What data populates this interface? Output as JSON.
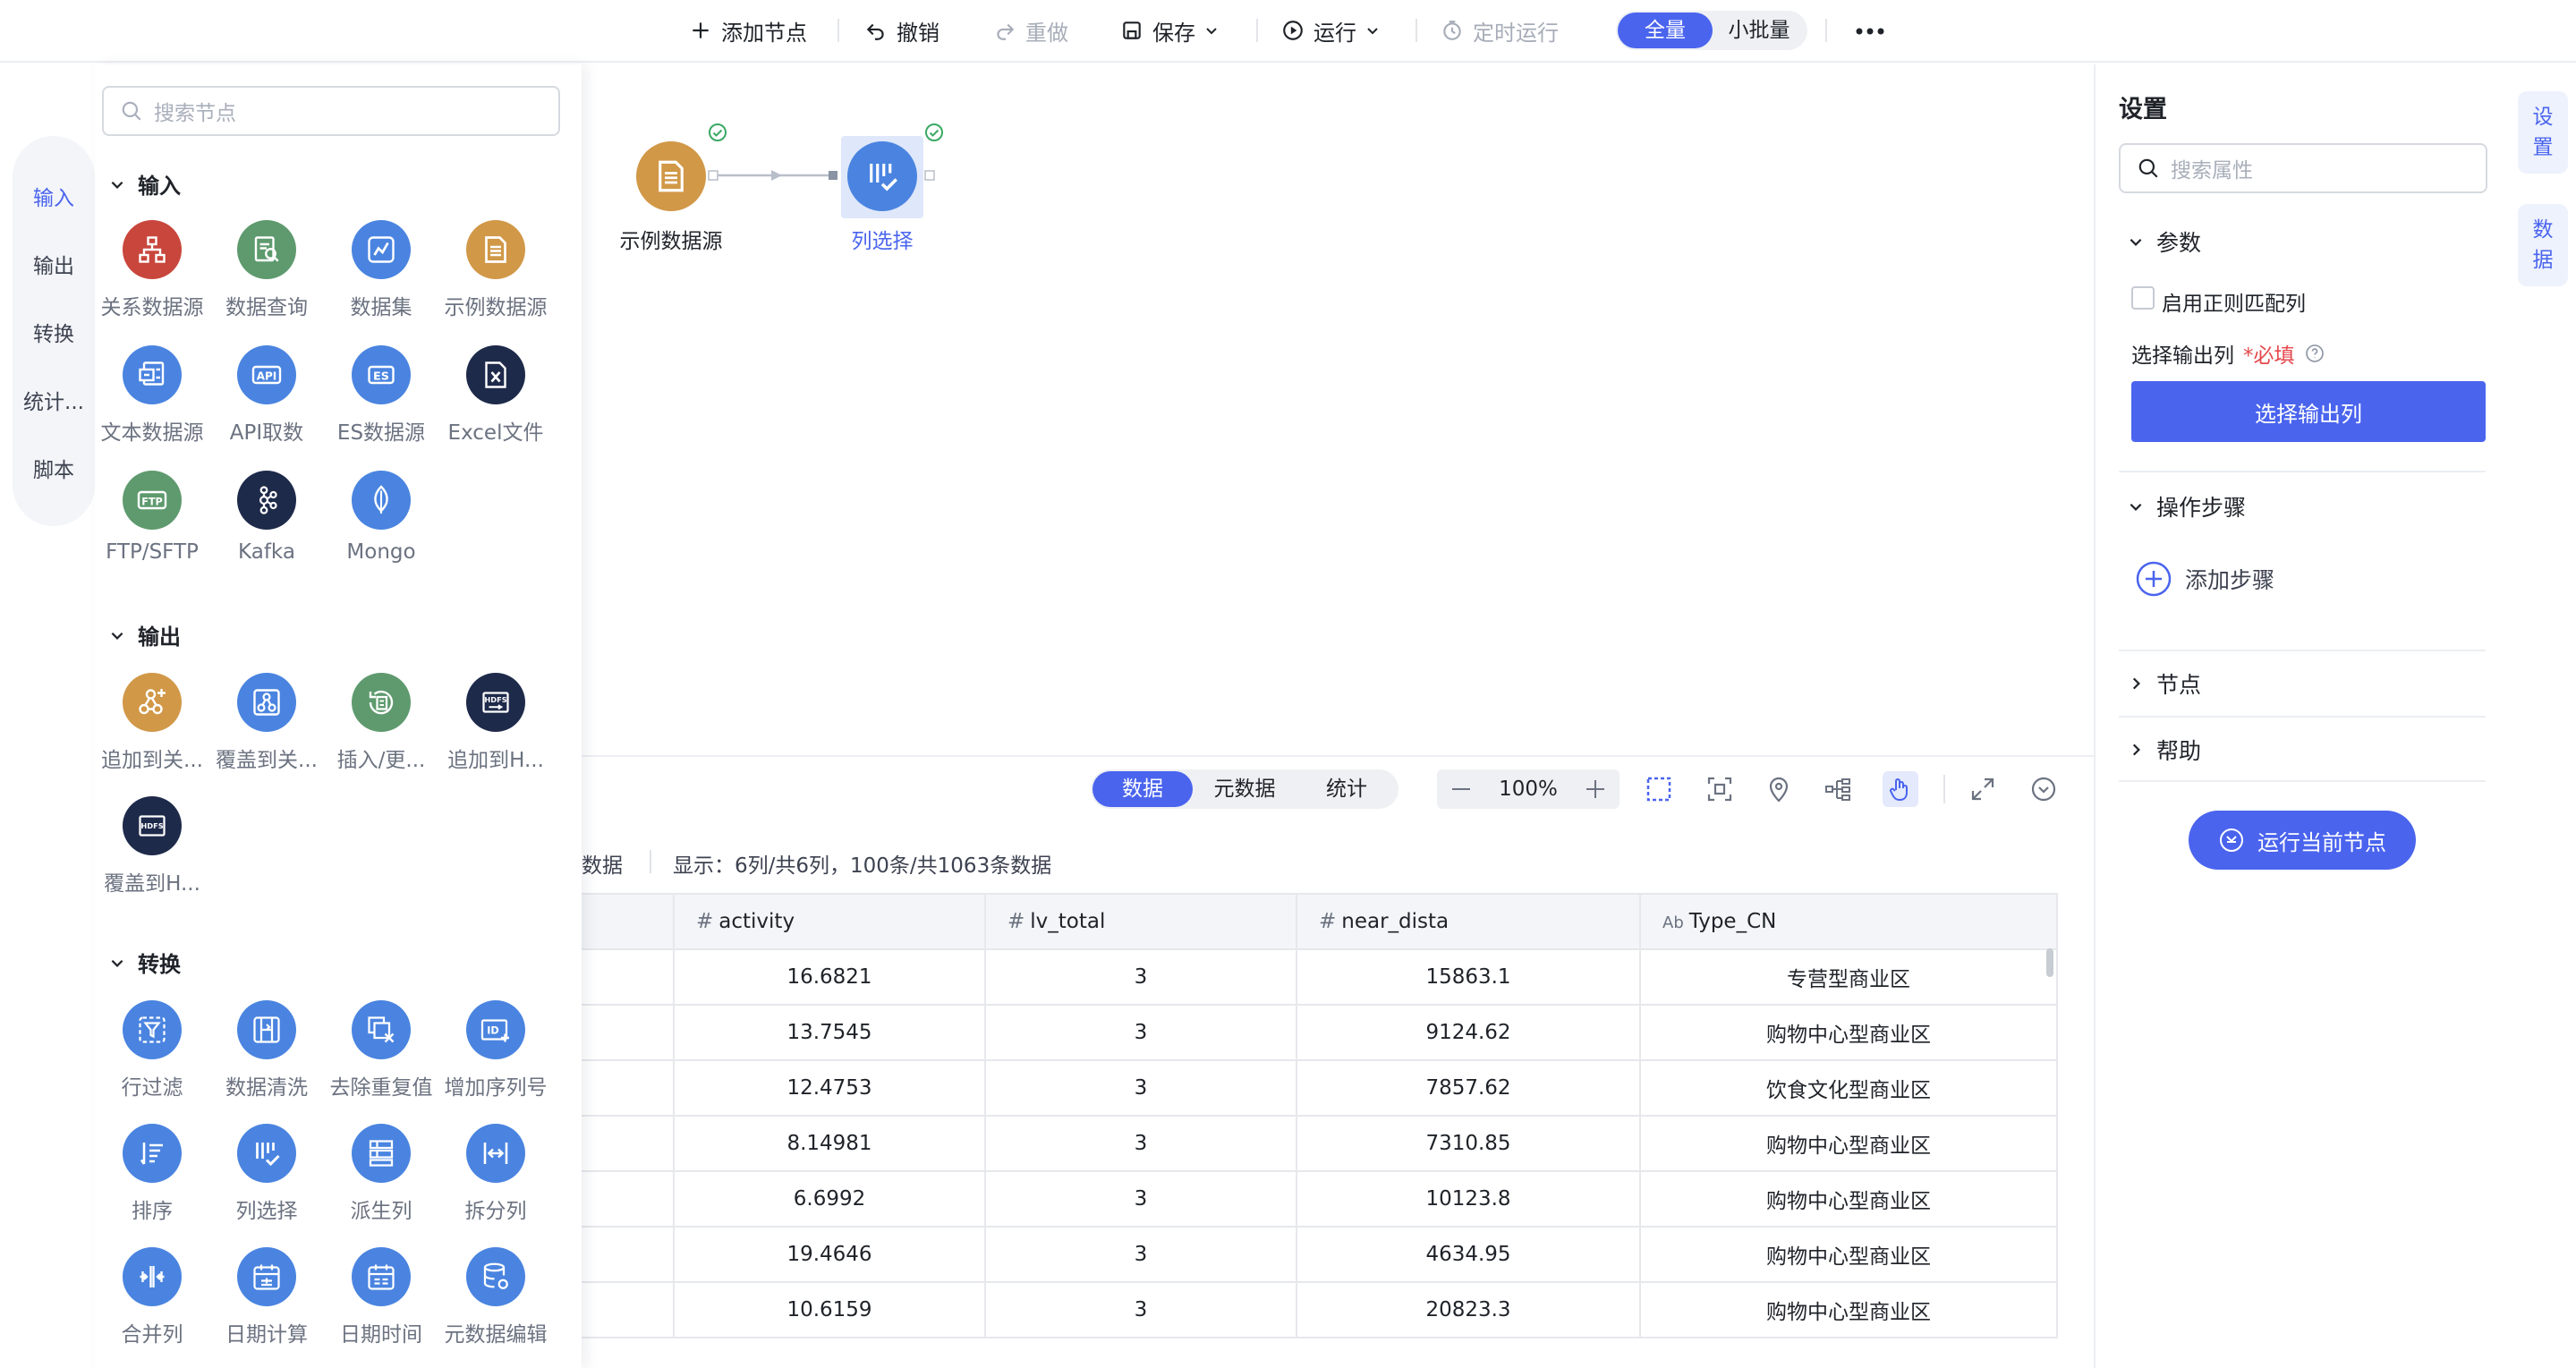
{
  "toolbar": {
    "add_node": "添加节点",
    "undo": "撤销",
    "redo": "重做",
    "save": "保存",
    "run": "运行",
    "schedule": "定时运行",
    "mode_full": "全量",
    "mode_small": "小批量",
    "more_icon": "more-horizontal-icon"
  },
  "rail": {
    "items": [
      {
        "label": "输入",
        "active": true
      },
      {
        "label": "输出",
        "active": false
      },
      {
        "label": "转换",
        "active": false
      },
      {
        "label": "统计...",
        "active": false
      },
      {
        "label": "脚本",
        "active": false
      }
    ]
  },
  "palette": {
    "search_placeholder": "搜索节点",
    "sections": [
      {
        "title": "输入",
        "nodes": [
          {
            "label": "关系数据源",
            "color": "#c8463c",
            "icon": "relational-db-icon"
          },
          {
            "label": "数据查询",
            "color": "#5e9a6e",
            "icon": "data-query-icon"
          },
          {
            "label": "数据集",
            "color": "#4a84e0",
            "icon": "dataset-icon"
          },
          {
            "label": "示例数据源",
            "color": "#d19848",
            "icon": "sample-datasource-icon"
          },
          {
            "label": "文本数据源",
            "color": "#4a84e0",
            "icon": "text-datasource-icon"
          },
          {
            "label": "API取数",
            "color": "#4a84e0",
            "icon": "api-icon",
            "glyph": "API"
          },
          {
            "label": "ES数据源",
            "color": "#4a84e0",
            "icon": "es-icon",
            "glyph": "ES"
          },
          {
            "label": "Excel文件",
            "color": "#1e2a4a",
            "icon": "excel-icon"
          },
          {
            "label": "FTP/SFTP",
            "color": "#5e9a6e",
            "icon": "ftp-icon",
            "glyph": "FTP"
          },
          {
            "label": "Kafka",
            "color": "#1e2a4a",
            "icon": "kafka-icon"
          },
          {
            "label": "Mongo",
            "color": "#4a84e0",
            "icon": "mongo-icon"
          }
        ]
      },
      {
        "title": "输出",
        "nodes": [
          {
            "label": "追加到关...",
            "color": "#d19848",
            "icon": "append-relational-icon"
          },
          {
            "label": "覆盖到关...",
            "color": "#4a84e0",
            "icon": "overwrite-relational-icon"
          },
          {
            "label": "插入/更...",
            "color": "#5e9a6e",
            "icon": "upsert-icon"
          },
          {
            "label": "追加到H...",
            "color": "#1e2a4a",
            "icon": "append-hdfs-icon",
            "glyph": "HDFS"
          },
          {
            "label": "覆盖到H...",
            "color": "#1e2a4a",
            "icon": "overwrite-hdfs-icon",
            "glyph": "HDFS"
          }
        ]
      },
      {
        "title": "转换",
        "nodes": [
          {
            "label": "行过滤",
            "color": "#4a84e0",
            "icon": "row-filter-icon"
          },
          {
            "label": "数据清洗",
            "color": "#4a84e0",
            "icon": "data-clean-icon"
          },
          {
            "label": "去除重复值",
            "color": "#4a84e0",
            "icon": "dedupe-icon"
          },
          {
            "label": "增加序列号",
            "color": "#4a84e0",
            "icon": "add-sequence-icon",
            "glyph": "ID"
          },
          {
            "label": "排序",
            "color": "#4a84e0",
            "icon": "sort-icon"
          },
          {
            "label": "列选择",
            "color": "#4a84e0",
            "icon": "column-select-icon"
          },
          {
            "label": "派生列",
            "color": "#4a84e0",
            "icon": "derived-column-icon"
          },
          {
            "label": "拆分列",
            "color": "#4a84e0",
            "icon": "split-column-icon"
          },
          {
            "label": "合并列",
            "color": "#4a84e0",
            "icon": "merge-column-icon"
          },
          {
            "label": "日期计算",
            "color": "#4a84e0",
            "icon": "date-calc-icon"
          },
          {
            "label": "日期时间",
            "color": "#4a84e0",
            "icon": "datetime-icon"
          },
          {
            "label": "元数据编辑",
            "color": "#4a84e0",
            "icon": "metadata-edit-icon"
          }
        ]
      }
    ]
  },
  "canvas": {
    "nodes": [
      {
        "label": "示例数据源",
        "color": "#d19848",
        "status": "success",
        "icon": "sample-datasource-icon"
      },
      {
        "label": "列选择",
        "color": "#4a84e0",
        "status": "success",
        "selected": true,
        "icon": "column-select-icon"
      }
    ]
  },
  "bottom_panel": {
    "tabs": [
      {
        "label": "数据",
        "active": true
      },
      {
        "label": "元数据",
        "active": false
      },
      {
        "label": "统计",
        "active": false
      }
    ],
    "zoom": "100%",
    "info_left": "数据",
    "info": "显示：6列/共6列，100条/共1063条数据"
  },
  "table": {
    "columns": [
      {
        "name": "",
        "type": ""
      },
      {
        "name": "activity",
        "type": "#"
      },
      {
        "name": "lv_total",
        "type": "#"
      },
      {
        "name": "near_dista",
        "type": "#"
      },
      {
        "name": "Type_CN",
        "type": "Ab"
      }
    ],
    "rows": [
      [
        "",
        "16.6821",
        "3",
        "15863.1",
        "专营型商业区"
      ],
      [
        "",
        "13.7545",
        "3",
        "9124.62",
        "购物中心型商业区"
      ],
      [
        "",
        "12.4753",
        "3",
        "7857.62",
        "饮食文化型商业区"
      ],
      [
        "",
        "8.14981",
        "3",
        "7310.85",
        "购物中心型商业区"
      ],
      [
        "",
        "6.6992",
        "3",
        "10123.8",
        "购物中心型商业区"
      ],
      [
        "",
        "19.4646",
        "3",
        "4634.95",
        "购物中心型商业区"
      ],
      [
        "",
        "10.6159",
        "3",
        "20823.3",
        "购物中心型商业区"
      ]
    ]
  },
  "settings": {
    "title": "设置",
    "search_placeholder": "搜索属性",
    "params_title": "参数",
    "regex_label": "启用正则匹配列",
    "output_col_label": "选择输出列",
    "required_mark": "*必填",
    "output_col_button": "选择输出列",
    "steps_title": "操作步骤",
    "add_step": "添加步骤",
    "node_title": "节点",
    "help_title": "帮助",
    "run_node_button": "运行当前节点"
  },
  "right_rail": {
    "items": [
      "设置",
      "数据"
    ]
  },
  "colors": {
    "accent": "#4a64ee",
    "success": "#3aa864"
  }
}
